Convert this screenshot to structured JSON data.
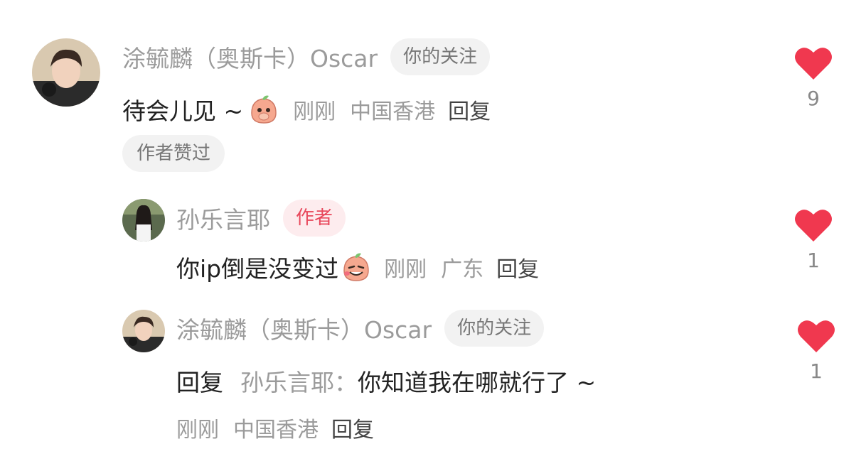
{
  "comments": [
    {
      "user": "涂毓麟（奥斯卡）Oscar",
      "tag": "你的关注",
      "text": "待会儿见 ~",
      "emoji": "peach-emoji-covering-mouth",
      "time": "刚刚",
      "location": "中国香港",
      "reply_label": "回复",
      "author_liked_tag": "作者赞过",
      "like_count": "9"
    },
    {
      "user": "孙乐言耶",
      "tag": "作者",
      "text": "你ip倒是没变过",
      "emoji": "peach-emoji-grinning",
      "time": "刚刚",
      "location": "广东",
      "reply_label": "回复",
      "like_count": "1"
    },
    {
      "user": "涂毓麟（奥斯卡）Oscar",
      "tag": "你的关注",
      "reply_prefix": "回复",
      "reply_to": "孙乐言耶：",
      "text": "你知道我在哪就行了 ~",
      "time": "刚刚",
      "location": "中国香港",
      "reply_label": "回复",
      "like_count": "1"
    }
  ],
  "colors": {
    "heart": "#f0384f",
    "author_tag_bg": "#fdecee",
    "author_tag_text": "#e8485c",
    "follow_tag_bg": "#f2f2f2"
  }
}
